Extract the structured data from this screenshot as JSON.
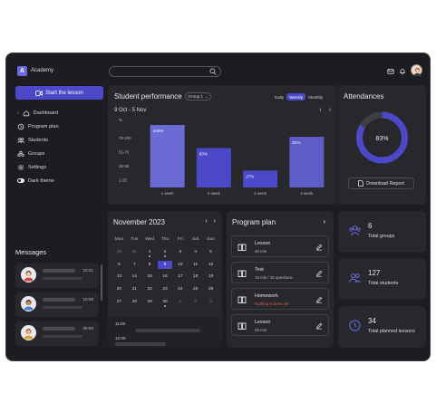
{
  "app": {
    "name": "Academy",
    "logo_letter": "A"
  },
  "search": {
    "placeholder": ""
  },
  "sidebar": {
    "start_label": "Start the lesson",
    "items": [
      {
        "label": "Dashboard",
        "icon": "home-icon"
      },
      {
        "label": "Program plan",
        "icon": "clock-icon"
      },
      {
        "label": "Students",
        "icon": "users-icon"
      },
      {
        "label": "Groups",
        "icon": "group-icon"
      },
      {
        "label": "Settings",
        "icon": "gear-icon"
      },
      {
        "label": "Dark theme",
        "icon": "toggle"
      }
    ],
    "messages_title": "Messages",
    "messages": [
      {
        "time": "10:21"
      },
      {
        "time": "10:08"
      },
      {
        "time": "09:56"
      }
    ]
  },
  "performance": {
    "title": "Student performance",
    "group": "Group 1",
    "tabs": [
      "Daily",
      "Weekly",
      "Monthly"
    ],
    "active_tab": "Weekly",
    "period": "9 Oct - 5 Nov",
    "chart_data": {
      "type": "bar",
      "ylabel": "%",
      "y_ticks": [
        "75-100",
        "51-75",
        "26-50",
        "1-25"
      ],
      "categories": [
        "1 week",
        "2 week",
        "3 week",
        "4 week"
      ],
      "values": [
        100,
        63,
        27,
        81
      ],
      "labels": [
        "100%",
        "63%",
        "27%",
        "81%"
      ],
      "colors": [
        "#6a6bd4",
        "#4b48c9",
        "#4b48c9",
        "#5c5dc7"
      ],
      "ylim": [
        0,
        100
      ]
    }
  },
  "attendances": {
    "title": "Attendances",
    "percent": "83%",
    "value": 0.83,
    "download_label": "Download Report"
  },
  "calendar": {
    "title": "November 2023",
    "weekdays": [
      "Mon",
      "Tue",
      "Wed",
      "Thu",
      "Fri",
      "Sat",
      "Sun"
    ],
    "days": [
      {
        "d": "30",
        "dim": true
      },
      {
        "d": "31",
        "dim": true
      },
      {
        "d": "1",
        "dot": true
      },
      {
        "d": "2",
        "dot": true
      },
      {
        "d": "3"
      },
      {
        "d": "4"
      },
      {
        "d": "5"
      },
      {
        "d": "6"
      },
      {
        "d": "7"
      },
      {
        "d": "8"
      },
      {
        "d": "9",
        "today": true
      },
      {
        "d": "10"
      },
      {
        "d": "11"
      },
      {
        "d": "12"
      },
      {
        "d": "13"
      },
      {
        "d": "14"
      },
      {
        "d": "15"
      },
      {
        "d": "16"
      },
      {
        "d": "17"
      },
      {
        "d": "18"
      },
      {
        "d": "19"
      },
      {
        "d": "20"
      },
      {
        "d": "21"
      },
      {
        "d": "22"
      },
      {
        "d": "23"
      },
      {
        "d": "24"
      },
      {
        "d": "25"
      },
      {
        "d": "26"
      },
      {
        "d": "27"
      },
      {
        "d": "28"
      },
      {
        "d": "29"
      },
      {
        "d": "30",
        "dot": true
      },
      {
        "d": "1",
        "dim": true
      },
      {
        "d": "2",
        "dim": true
      },
      {
        "d": "3",
        "dim": true
      }
    ],
    "schedule": [
      {
        "time": "11:00"
      },
      {
        "time": "12:00"
      }
    ]
  },
  "program_plan": {
    "title": "Program plan",
    "items": [
      {
        "name": "Lesson",
        "sub": "40 min",
        "warn": false
      },
      {
        "name": "Test",
        "sub": "15 min / 10 questions",
        "warn": false
      },
      {
        "name": "Homework",
        "sub": "Nothing is done yet",
        "warn": true
      },
      {
        "name": "Lesson",
        "sub": "25 min",
        "warn": false
      }
    ]
  },
  "stats": [
    {
      "num": "6",
      "label": "Total groups",
      "icon": "groups-icon"
    },
    {
      "num": "127",
      "label": "Total students",
      "icon": "students-icon"
    },
    {
      "num": "34",
      "label": "Total planned lessons",
      "icon": "lessons-icon"
    }
  ],
  "colors": {
    "accent": "#4b48c9",
    "bg": "#1d1d21",
    "card": "#27272c",
    "warn": "#e0605c"
  }
}
